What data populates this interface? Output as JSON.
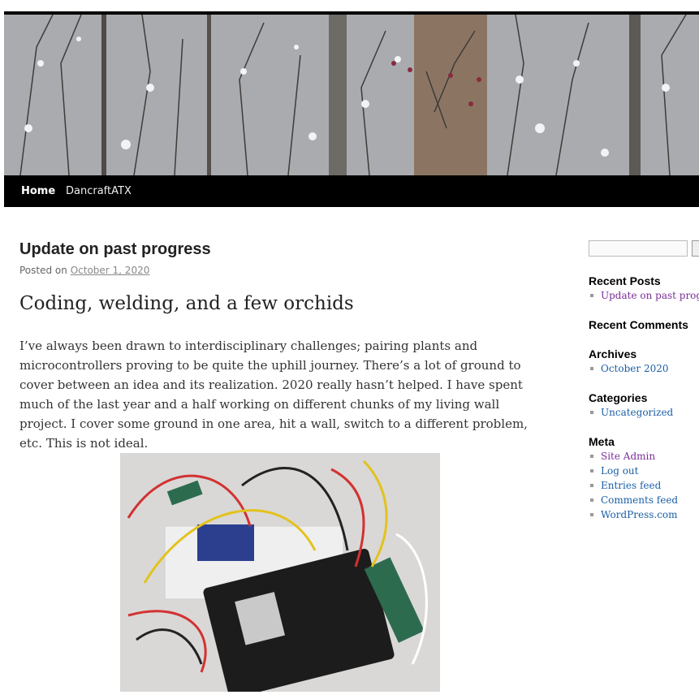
{
  "nav": {
    "items": [
      {
        "label": "Home",
        "active": true
      },
      {
        "label": "DancraftATX",
        "active": false
      }
    ]
  },
  "post": {
    "title": "Update on past progress",
    "meta_prefix": "Posted on",
    "date": "October 1, 2020",
    "subheading": "Coding, welding, and a few orchids",
    "paragraph": "I’ve always been drawn to interdisciplinary challenges; pairing plants and microcontrollers proving to be quite the uphill journey. There’s a lot of ground to cover between an idea and its realization. 2020 really hasn’t helped. I have spent much of the last year and a half working on different chunks of my living wall project. I cover some ground in one area, hit a wall, switch to a different problem, etc. This is not ideal."
  },
  "sidebar": {
    "search": {
      "placeholder": ""
    },
    "recent_posts": {
      "title": "Recent Posts",
      "items": [
        "Update on past progress"
      ]
    },
    "recent_comments": {
      "title": "Recent Comments"
    },
    "archives": {
      "title": "Archives",
      "items": [
        "October 2020"
      ]
    },
    "categories": {
      "title": "Categories",
      "items": [
        "Uncategorized"
      ]
    },
    "meta": {
      "title": "Meta",
      "items": [
        "Site Admin",
        "Log out",
        "Entries feed",
        "Comments feed",
        "WordPress.com"
      ]
    }
  },
  "colors": {
    "link": "#1b5fa6",
    "visited_link": "#7b2d9a",
    "nav_bg": "#000000"
  },
  "icons": {
    "header": "snowy-forest-image",
    "photo": "microcontroller-photo"
  }
}
